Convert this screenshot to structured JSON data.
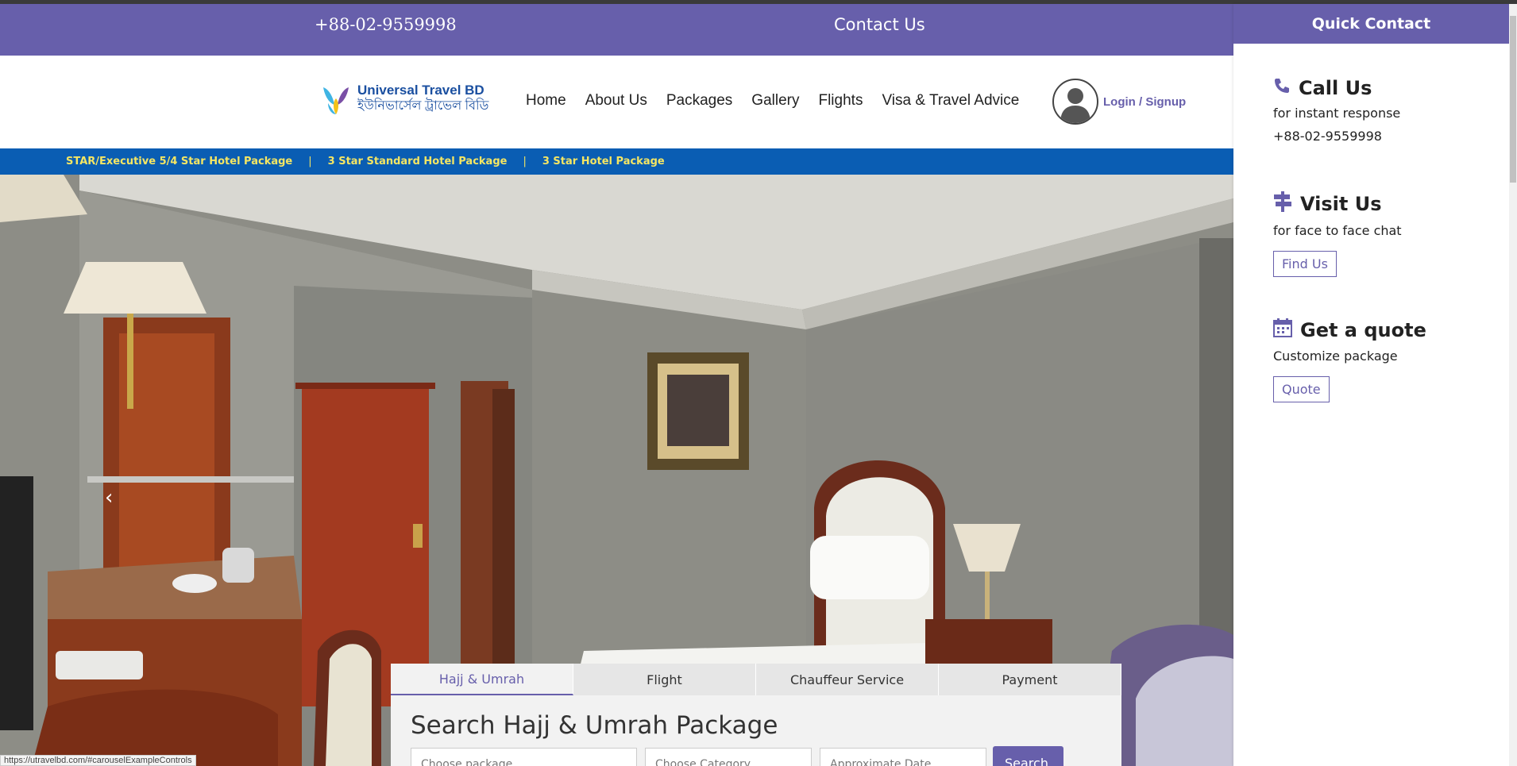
{
  "topbar": {
    "phone": "+88-02-9559998",
    "contact_label": "Contact Us"
  },
  "brand": {
    "name_en": "Universal Travel BD",
    "name_bn": "ইউনিভার্সেল ট্রাভেল বিডি"
  },
  "nav": {
    "items": [
      "Home",
      "About Us",
      "Packages",
      "Gallery",
      "Flights",
      "Visa & Travel Advice"
    ],
    "login_label": "Login / Signup"
  },
  "packages_bar": {
    "items": [
      "STAR/Executive 5/4 Star Hotel Package",
      "3 Star Standard Hotel Package",
      "3 Star Hotel Package"
    ],
    "separator": "|"
  },
  "hero": {
    "prev_icon": "chevron-left-icon",
    "prev_glyph": "‹"
  },
  "search": {
    "tabs": [
      "Hajj & Umrah",
      "Flight",
      "Chauffeur Service",
      "Payment"
    ],
    "active_tab": "Hajj & Umrah",
    "title": "Search Hajj & Umrah Package",
    "field1_placeholder": "Choose package",
    "field2_placeholder": "Choose Category",
    "field3_placeholder": "Approximate Date",
    "search_label": "Search"
  },
  "status_url": "https://utravelbd.com/#carouselExampleControls",
  "quick_contact": {
    "header": "Quick Contact",
    "call": {
      "title": "Call Us",
      "sub": "for instant response",
      "phone": "+88-02-9559998",
      "icon": "phone-icon"
    },
    "visit": {
      "title": "Visit Us",
      "sub": "for face to face chat",
      "button": "Find Us",
      "icon": "signpost-icon"
    },
    "quote": {
      "title": "Get a quote",
      "sub": "Customize package",
      "button": "Quote",
      "icon": "calendar-icon"
    }
  },
  "colors": {
    "brand_purple": "#675fab",
    "package_bar_blue": "#0a5db3",
    "package_text_yellow": "#f5e663"
  }
}
